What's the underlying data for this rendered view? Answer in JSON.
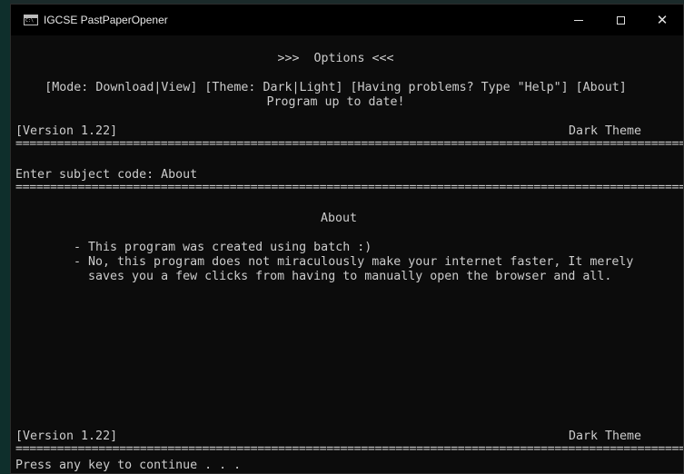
{
  "window": {
    "title": "IGCSE PastPaperOpener",
    "minimize_glyph": "",
    "maximize_glyph": "",
    "close_glyph": "✕"
  },
  "console": {
    "options_heading": ">>>  Options <<<",
    "options_line": "[Mode: Download|View] [Theme: Dark|Light] [Having problems? Type \"Help\"] [About]",
    "status_line": "Program up to date!",
    "version": "[Version 1.22]",
    "theme_label": "Dark Theme",
    "separator": "==========================================================================================================",
    "prompt": "Enter subject code: About",
    "about_heading": "About",
    "about_line1": "- This program was created using batch :)",
    "about_line2": "- No, this program does not miraculously make your internet faster, It merely",
    "about_line3": "  saves you a few clicks from having to manually open the browser and all.",
    "footer_version": "[Version 1.22]",
    "footer_theme": "Dark Theme",
    "continue_prompt": "Press any key to continue . . ."
  },
  "colors": {
    "console_bg": "#0c0c0c",
    "console_text": "#cccccc",
    "titlebar_bg": "#000000"
  },
  "icons": {
    "app": "console-app-icon",
    "minimize": "minimize-icon",
    "maximize": "maximize-icon",
    "close": "close-icon"
  }
}
